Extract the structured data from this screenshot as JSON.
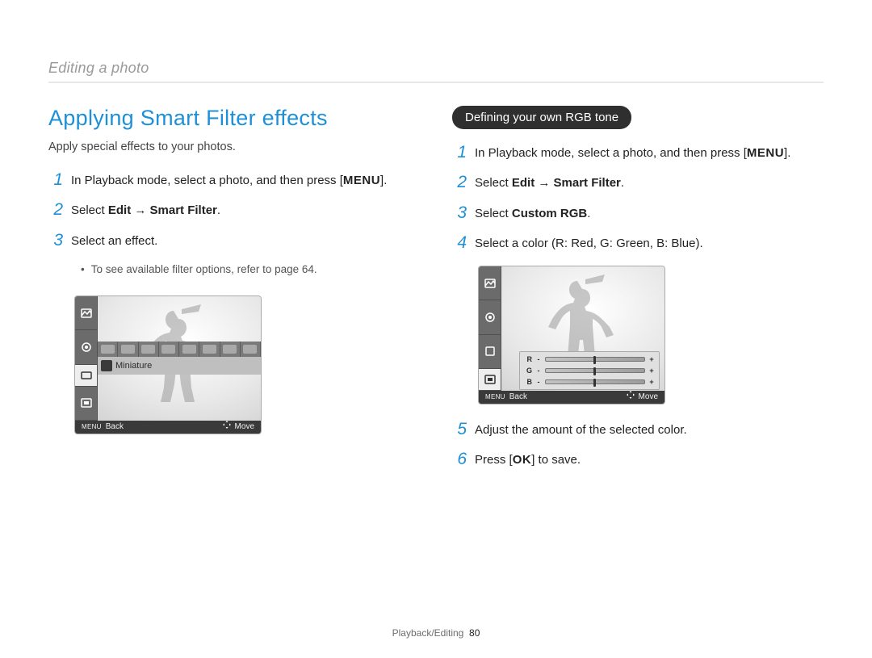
{
  "breadcrumb": "Editing a photo",
  "left": {
    "title": "Applying Smart Filter effects",
    "subtitle": "Apply special effects to your photos.",
    "steps": {
      "s1_pre": "In Playback mode, select a photo, and then press [",
      "s1_menu": "MENU",
      "s1_post": "].",
      "s2_pre": "Select ",
      "s2_bold": "Edit → Smart Filter",
      "s2_post": ".",
      "s3": "Select an effect."
    },
    "bullet": "To see available filter options, refer to page 64."
  },
  "right": {
    "pill": "Defining your own RGB tone",
    "steps": {
      "s1_pre": "In Playback mode, select a photo, and then press [",
      "s1_menu": "MENU",
      "s1_post": "].",
      "s2_pre": "Select ",
      "s2_bold": "Edit → Smart Filter",
      "s2_post": ".",
      "s3_pre": "Select ",
      "s3_bold": "Custom RGB",
      "s3_post": ".",
      "s4": "Select a color (R: Red, G: Green, B: Blue).",
      "s5": "Adjust the amount of the selected color.",
      "s6_pre": "Press [",
      "s6_ok": "OK",
      "s6_post": "] to save."
    }
  },
  "screen_left": {
    "filter_label": "Miniature",
    "back_label": "Back",
    "move_label": "Move",
    "menu_tag": "MENU"
  },
  "screen_right": {
    "rgb": {
      "r": "R",
      "g": "G",
      "b": "B"
    },
    "back_label": "Back",
    "move_label": "Move",
    "menu_tag": "MENU"
  },
  "footer": {
    "section": "Playback/Editing",
    "page": "80"
  },
  "nums": {
    "n1": "1",
    "n2": "2",
    "n3": "3",
    "n4": "4",
    "n5": "5",
    "n6": "6"
  }
}
